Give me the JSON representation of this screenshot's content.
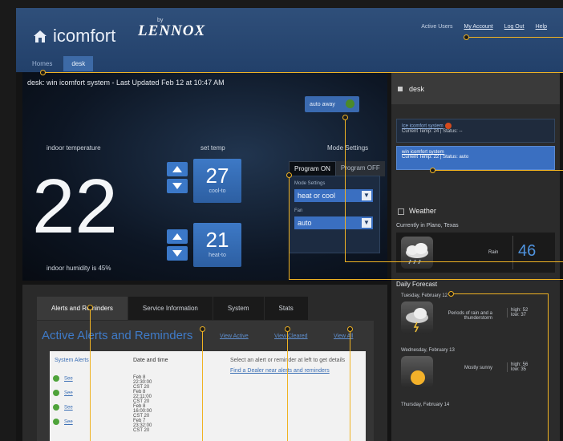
{
  "header": {
    "brand": "icomfort",
    "lennox_by": "by",
    "lennox": "LENNOX",
    "active_user": "Active Users",
    "links": [
      "My Account",
      "Log Out",
      "Help"
    ]
  },
  "top_tabs": [
    "Homes",
    "desk"
  ],
  "panel": {
    "title": "desk: win icomfort system - Last Updated Feb 12 at 10:47 AM",
    "auto_button": "auto away",
    "indoor_label": "indoor temperature",
    "indoor_temp": "22",
    "humidity": "indoor humidity is 45%",
    "settemp_label": "set temp",
    "cool_value": "27",
    "cool_caption": "cool-to",
    "heat_value": "21",
    "heat_caption": "heat-to",
    "mode_label": "Mode Settings",
    "program_on": "Program ON",
    "program_off": "Program OFF",
    "mode_field_label": "Mode Settings",
    "mode_value": "heat or cool",
    "fan_label": "Fan",
    "fan_value": "auto"
  },
  "bottom_tabs": [
    "Alerts and Reminders",
    "Service Information",
    "System",
    "Stats"
  ],
  "alerts": {
    "title": "Active Alerts and Reminders",
    "links": [
      "View Active",
      "View Cleared",
      "View All"
    ],
    "col_system": "System Alerts",
    "col_date": "Date and time",
    "hint": "Select an alert or reminder at left to get details",
    "hint_link": "Find a Dealer near alerts and reminders",
    "rows": [
      {
        "view": "See",
        "date": "Feb 8 22:30:00 CST 20"
      },
      {
        "view": "See",
        "date": "Feb 8 22:11:00 CST 20"
      },
      {
        "view": "See",
        "date": "Feb 8 16:00:00 CST 20"
      },
      {
        "view": "See",
        "date": "Feb 7 23:32:00 CST 20"
      }
    ]
  },
  "sidebar": {
    "home": "desk",
    "systems": [
      {
        "name": "Ice icomfort system",
        "line": "Current Temp: 24  |  Status: --"
      },
      {
        "name": "win icomfort system",
        "line": "Current Temp: 22  |  Status: auto"
      }
    ],
    "weather_title": "Weather",
    "location": "Currently in Plano, Texas",
    "current_desc": "Rain",
    "current_temp": "46",
    "forecast_title": "Daily Forecast",
    "forecast": [
      {
        "day": "Tuesday, February 12",
        "desc": "Periods of rain and a thunderstorm",
        "high": "high: 52",
        "low": "low: 37"
      },
      {
        "day": "Wednesday, February 13",
        "desc": "Mostly sunny",
        "high": "high: 56",
        "low": "low: 35"
      },
      {
        "day": "Thursday, February 14",
        "desc": "",
        "high": "",
        "low": ""
      }
    ]
  },
  "colors": {
    "accent": "#3a6fc1",
    "callout": "#f0b323",
    "header": "#2f4f7a"
  }
}
